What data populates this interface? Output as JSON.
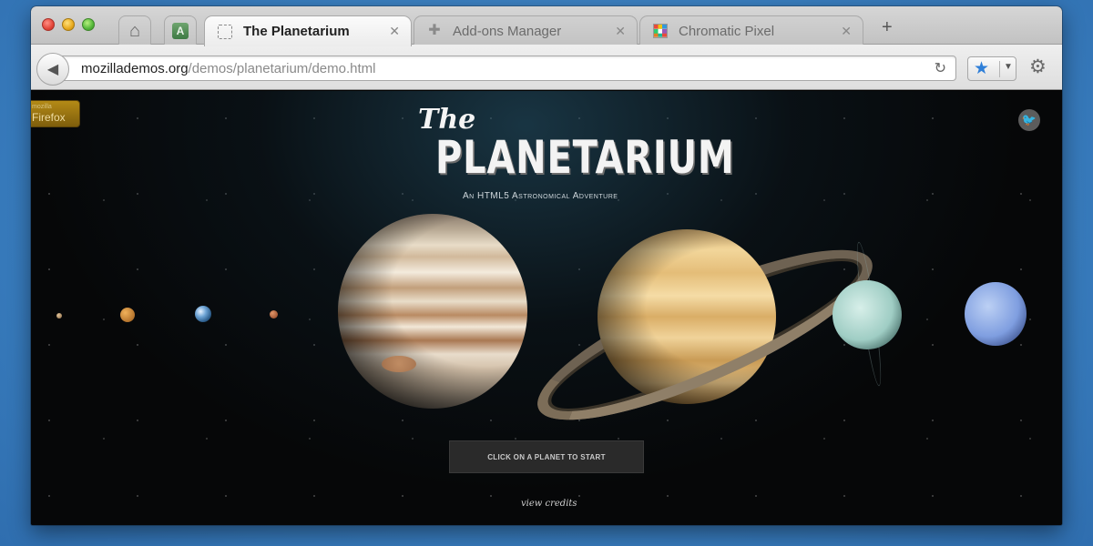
{
  "window": {
    "tabs": [
      {
        "title": "The Planetarium",
        "favicon": "dashed-square-icon",
        "active": true,
        "close": "✕"
      },
      {
        "title": "Add-ons Manager",
        "favicon": "puzzle-icon",
        "active": false,
        "close": "✕"
      },
      {
        "title": "Chromatic Pixel",
        "favicon": "pixel-grid-icon",
        "active": false,
        "close": "✕"
      }
    ],
    "new_tab_label": "+"
  },
  "navbar": {
    "url_domain": "mozillademos.org",
    "url_path": "/demos/planetarium/demo.html"
  },
  "page": {
    "badge_small": "mozilla",
    "badge_text": "Firefox",
    "title_the": "The",
    "title_main": "PLANETARIUM",
    "subtitle": "An HTML5 Astronomical Adventure",
    "start_button": "CLICK ON A PLANET TO START",
    "credits_link": "view credits",
    "planets": [
      "Mercury",
      "Venus",
      "Earth",
      "Mars",
      "Jupiter",
      "Saturn",
      "Uranus",
      "Neptune"
    ]
  },
  "colors": {
    "background_blue": "#3a7fc0",
    "bookmark_star": "#2f7fd8",
    "space_black": "#060708"
  }
}
